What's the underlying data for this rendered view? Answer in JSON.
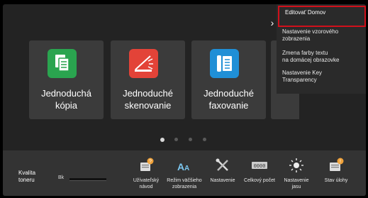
{
  "tiles": [
    {
      "label": "Jednoduchá\nkópia",
      "color": "#2aa44f",
      "icon": "copy-icon"
    },
    {
      "label": "Jednoduché\nskenovanie",
      "color": "#e34338",
      "icon": "scanner-icon"
    },
    {
      "label": "Jednoduché\nfaxovanie",
      "color": "#1f8fd6",
      "icon": "fax-icon"
    }
  ],
  "menu": {
    "items": [
      "Editovať Domov",
      "Nastavenie vzorového\nzobrazenia",
      "Zmena farby textu\nna domácej obrazovke",
      "Nastavenie Key\nTransparency"
    ]
  },
  "pager": {
    "active_page": 1,
    "page_count": 4
  },
  "toner": {
    "label": "Kvalita\ntoneru",
    "color_label": "Bk"
  },
  "bottom_buttons": [
    {
      "label": "Užívateľský\nnávod",
      "icon": "manual-icon"
    },
    {
      "label": "Režim väčšieho\nzobrazenia",
      "icon": "large-text-icon"
    },
    {
      "label": "Nastavenie",
      "icon": "tools-icon"
    },
    {
      "label": "Celkový počet",
      "icon": "counter-icon"
    },
    {
      "label": "Nastavenie\njasu",
      "icon": "brightness-icon"
    },
    {
      "label": "Stav úlohy",
      "icon": "job-status-icon"
    }
  ],
  "colors": {
    "highlight": "#d0101b",
    "accent": "#f0a23a"
  }
}
